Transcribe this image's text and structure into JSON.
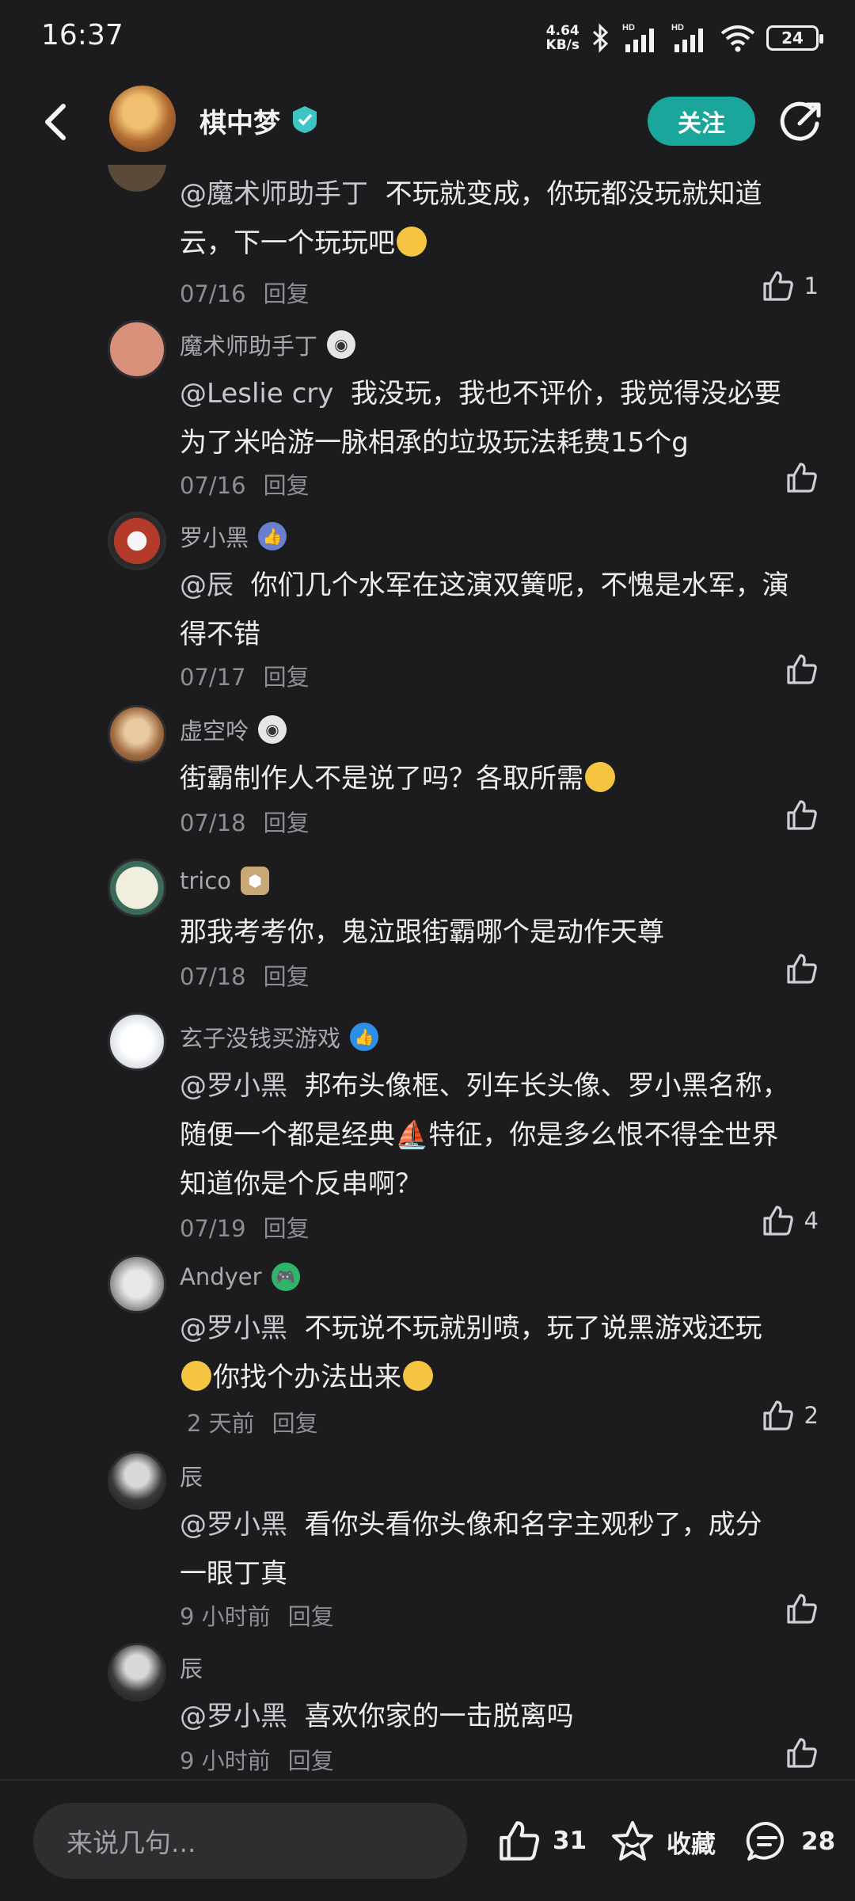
{
  "status_bar": {
    "time": "16:37",
    "net_speed_value": "4.64",
    "net_speed_unit": "KB/s",
    "battery": "24"
  },
  "header": {
    "name": "棋中梦",
    "follow_label": "关注"
  },
  "comments": [
    {
      "partial": true,
      "mention": "@魔术师助手丁",
      "text_a": "不玩就变成，你玩都没玩就知道",
      "text_b": "云，下一个玩玩吧",
      "date": "07/16",
      "reply": "回复",
      "likes": "1"
    },
    {
      "name": "魔术师助手丁",
      "mention": "@Leslie cry",
      "text_a": "我没玩，我也不评价，我觉得没必要",
      "text_b": "为了米哈游一脉相承的垃圾玩法耗费15个g",
      "date": "07/16",
      "reply": "回复"
    },
    {
      "name": "罗小黑",
      "mention": "@辰",
      "text_a": "你们几个水军在这演双簧呢，不愧是水军，演",
      "text_b": "得不错",
      "date": "07/17",
      "reply": "回复"
    },
    {
      "name": "虚空呤",
      "text_a": "街霸制作人不是说了吗？各取所需",
      "date": "07/18",
      "reply": "回复"
    },
    {
      "name": "trico",
      "text_a": "那我考考你，鬼泣跟街霸哪个是动作天尊",
      "date": "07/18",
      "reply": "回复"
    },
    {
      "name": "玄子没钱买游戏",
      "mention": "@罗小黑",
      "text_a": "邦布头像框、列车长头像、罗小黑名称，",
      "text_b": "随便一个都是经典",
      "text_b2": "特征，你是多么恨不得全世界",
      "text_c": "知道你是个反串啊？",
      "date": "07/19",
      "reply": "回复",
      "likes": "4"
    },
    {
      "name": "Andyer",
      "mention": "@罗小黑",
      "text_a": "不玩说不玩就别喷，玩了说黑游戏还玩",
      "text_b": "你找个办法出来",
      "date": "2 天前",
      "reply": "回复",
      "likes": "2"
    },
    {
      "name": "辰",
      "mention": "@罗小黑",
      "text_a": "看你头看你头像和名字主观秒了，成分",
      "text_b": "一眼丁真",
      "date": "9 小时前",
      "reply": "回复"
    },
    {
      "name": "辰",
      "mention": "@罗小黑",
      "text_a": "喜欢你家的一击脱离吗",
      "date": "9 小时前",
      "reply": "回复"
    }
  ],
  "bottom_bar": {
    "input_placeholder": "来说几句...",
    "like_count": "31",
    "favorite_label": "收藏",
    "comment_count": "28"
  },
  "colors": {
    "background": "#1c1c1e",
    "accent": "#1aa69a",
    "like_icon": "#d0d0d4"
  },
  "icons": [
    "back-arrow-icon",
    "verified-badge-icon",
    "share-icon",
    "thumb-up-icon",
    "star-icon",
    "comment-icon",
    "bluetooth-icon",
    "signal-icon",
    "wifi-icon"
  ]
}
